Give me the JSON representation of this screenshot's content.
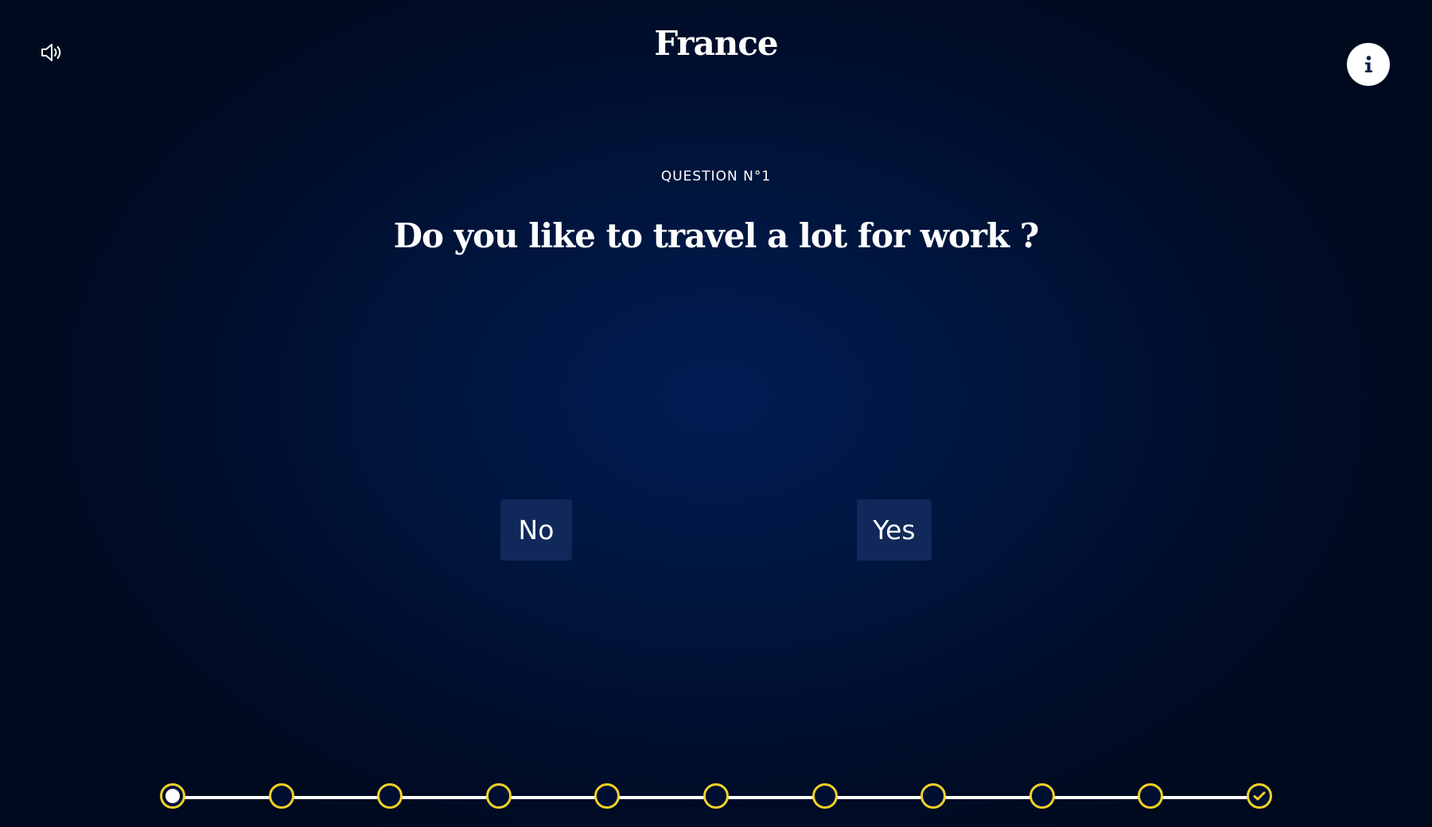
{
  "header": {
    "title": "France",
    "sound_icon": "speaker-volume-icon",
    "info_icon": "info-icon"
  },
  "question": {
    "number_label": "QUESTION N°1",
    "text": "Do you like to travel a lot for work ?"
  },
  "answers": {
    "no_label": "No",
    "yes_label": "Yes"
  },
  "progress": {
    "total_steps": 11,
    "current_step": 1,
    "final_step_icon": "check-icon"
  },
  "colors": {
    "background": "#00163f",
    "button_bg": "#10295a",
    "accent_yellow": "#f2d225",
    "text": "#ffffff"
  }
}
